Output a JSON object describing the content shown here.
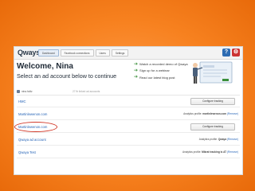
{
  "app": {
    "logo": "Qways"
  },
  "tabs": [
    "Dashboard",
    "Facebook connections",
    "Users",
    "Settings"
  ],
  "topbar_icons": {
    "help": "?",
    "settings": "⚙"
  },
  "welcome": {
    "title": "Welcome, Nina",
    "subtitle": "Select an ad account below to continue"
  },
  "promos": [
    "Watch a recorded demo of Qwaya",
    "Sign up for a webinar",
    "Read our latest blog post"
  ],
  "user": {
    "name": "nina.holtz",
    "meta": "27 fb linked ad accounts"
  },
  "accounts": [
    {
      "name": "HMC",
      "info": "",
      "action": "Configure tracking"
    },
    {
      "name": "Martinlewenon.com",
      "info_prefix": "Analytics profile: ",
      "info_value": "martinlewenon.com",
      "info_link": " (Remove)",
      "action": ""
    },
    {
      "name": "Martinlewenon.com",
      "info": "",
      "action": "Configure tracking"
    },
    {
      "name": "Qwaya ad account",
      "info_prefix": "Analytics profile: ",
      "info_value": "Qwaya",
      "info_link": " (Remove)",
      "action": ""
    },
    {
      "name": "Qwaya Test",
      "info_prefix": "Analytics profile: ",
      "info_value": "Mikrat tracking is AT",
      "info_link": " (Remove)",
      "action": ""
    }
  ],
  "colors": {
    "frame_orange": "#f7811f",
    "link_blue": "#2563b6",
    "highlight_red": "#d23a2a"
  }
}
